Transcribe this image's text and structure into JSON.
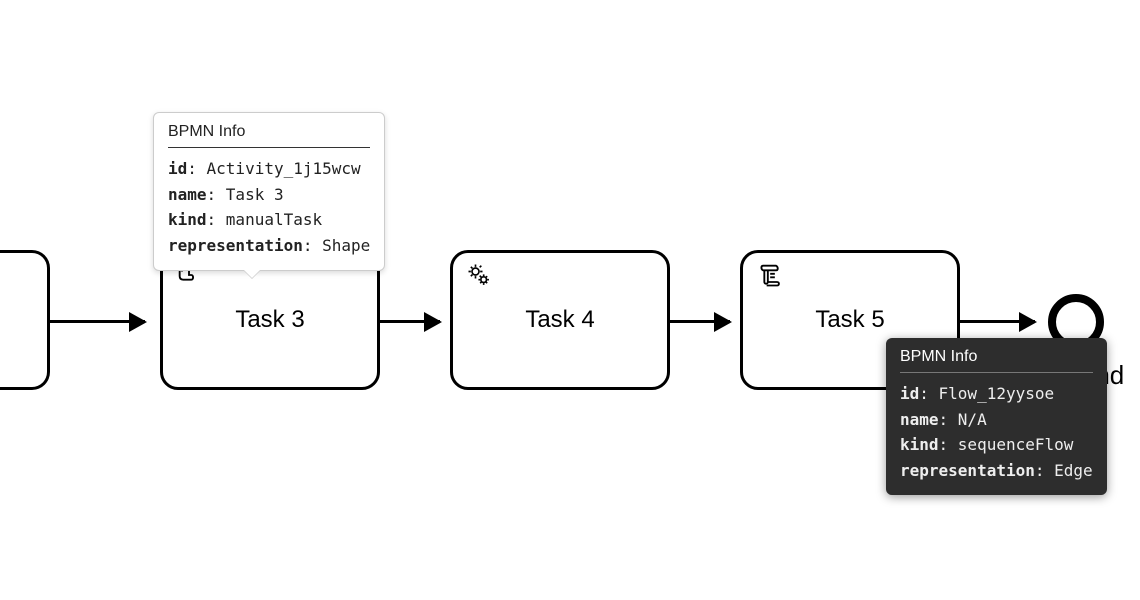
{
  "tasks": {
    "t3": {
      "label": "Task 3"
    },
    "t4": {
      "label": "Task 4"
    },
    "t5": {
      "label": "Task 5"
    }
  },
  "end_label": "End",
  "light_tooltip": {
    "title": "BPMN Info",
    "id_label": "id",
    "id_value": "Activity_1j15wcw",
    "name_label": "name",
    "name_value": "Task 3",
    "kind_label": "kind",
    "kind_value": "manualTask",
    "rep_label": "representation",
    "rep_value": "Shape"
  },
  "dark_tooltip": {
    "title": "BPMN Info",
    "id_label": "id",
    "id_value": "Flow_12yysoe",
    "name_label": "name",
    "name_value": "N/A",
    "kind_label": "kind",
    "kind_value": "sequenceFlow",
    "rep_label": "representation",
    "rep_value": "Edge"
  }
}
